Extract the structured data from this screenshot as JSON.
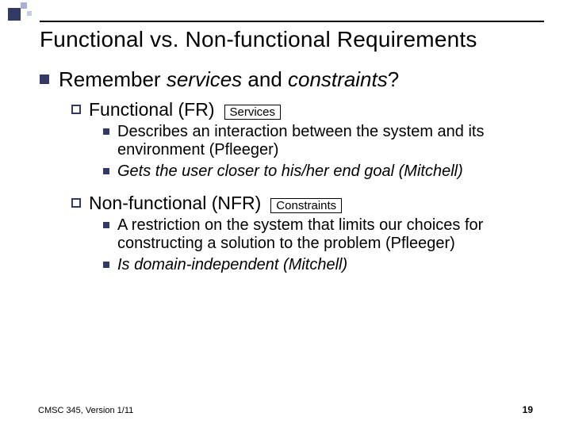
{
  "title": "Functional vs. Non-functional Requirements",
  "remember": {
    "pre": "Remember ",
    "emph": "services",
    "mid": " and ",
    "emph2": "constraints",
    "post": "?"
  },
  "sections": [
    {
      "heading": {
        "label": "Functional",
        "paren": "(FR)",
        "tag": "Services"
      },
      "items": [
        {
          "text": "Describes an interaction between the system and its environment (Pfleeger)",
          "italic": false
        },
        {
          "text": "Gets the user closer to his/her end goal (Mitchell)",
          "italic": true
        }
      ]
    },
    {
      "heading": {
        "label": "Non-functional",
        "paren": "(NFR)",
        "tag": "Constraints"
      },
      "items": [
        {
          "text": "A restriction on the system that limits our choices for constructing a solution to the problem (Pfleeger)",
          "italic": false
        },
        {
          "text": "Is domain-independent (Mitchell)",
          "italic": true
        }
      ]
    }
  ],
  "footer": {
    "course": "CMSC 345, Version 1/11",
    "page": "19"
  }
}
